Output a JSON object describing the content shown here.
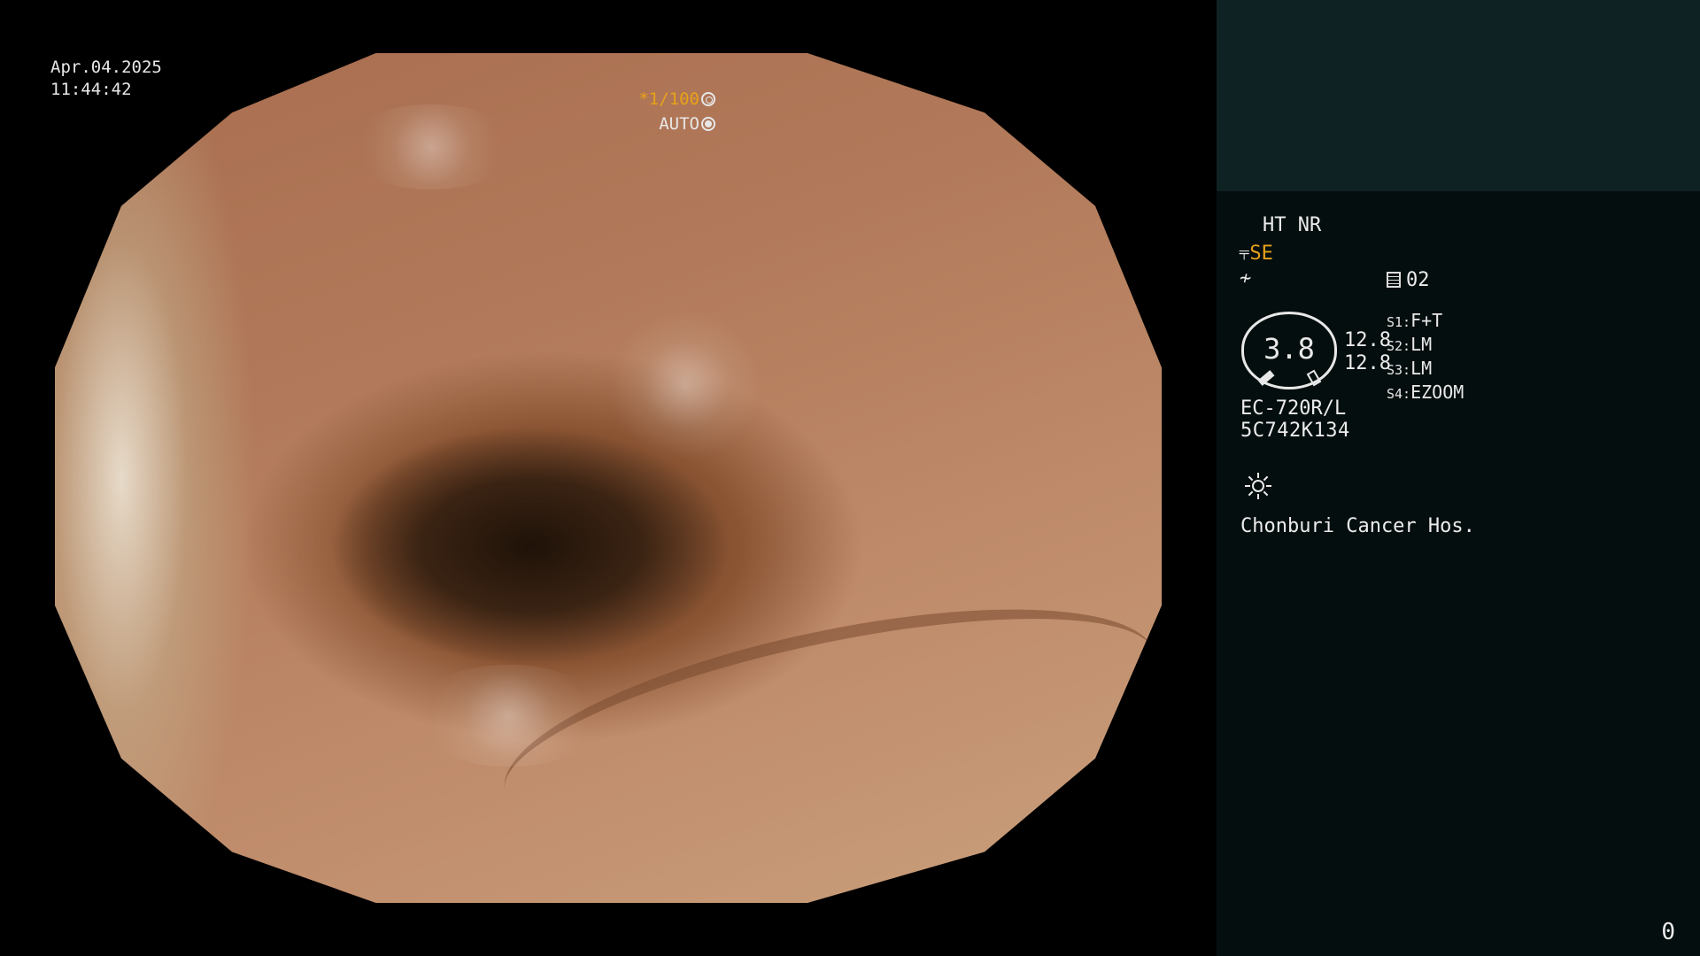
{
  "overlay": {
    "date": "Apr.04.2025",
    "time": "11:44:42",
    "shutter_speed": "*1/100",
    "mode": "AUTO"
  },
  "panel": {
    "mode_line": "HT NR",
    "enhance_prefix": "⫧",
    "enhance_label": "SE",
    "grad_symbol": "≁",
    "memory_count": "02",
    "gauge_value": "3.8",
    "scale_top": "12.8",
    "scale_bottom": "12.8",
    "switches": [
      {
        "key": "S1:",
        "value": "F+T"
      },
      {
        "key": "S2:",
        "value": "LM"
      },
      {
        "key": "S3:",
        "value": "LM"
      },
      {
        "key": "S4:",
        "value": "EZOOM"
      }
    ],
    "scope_model": "EC-720R/L",
    "scope_serial": "5C742K134",
    "hospital": "Chonburi Cancer Hos.",
    "frame_counter": "0"
  },
  "colors": {
    "accent_orange": "#e8a21a",
    "panel_top_bg": "#0e2223",
    "panel_bg": "#050e0e"
  }
}
